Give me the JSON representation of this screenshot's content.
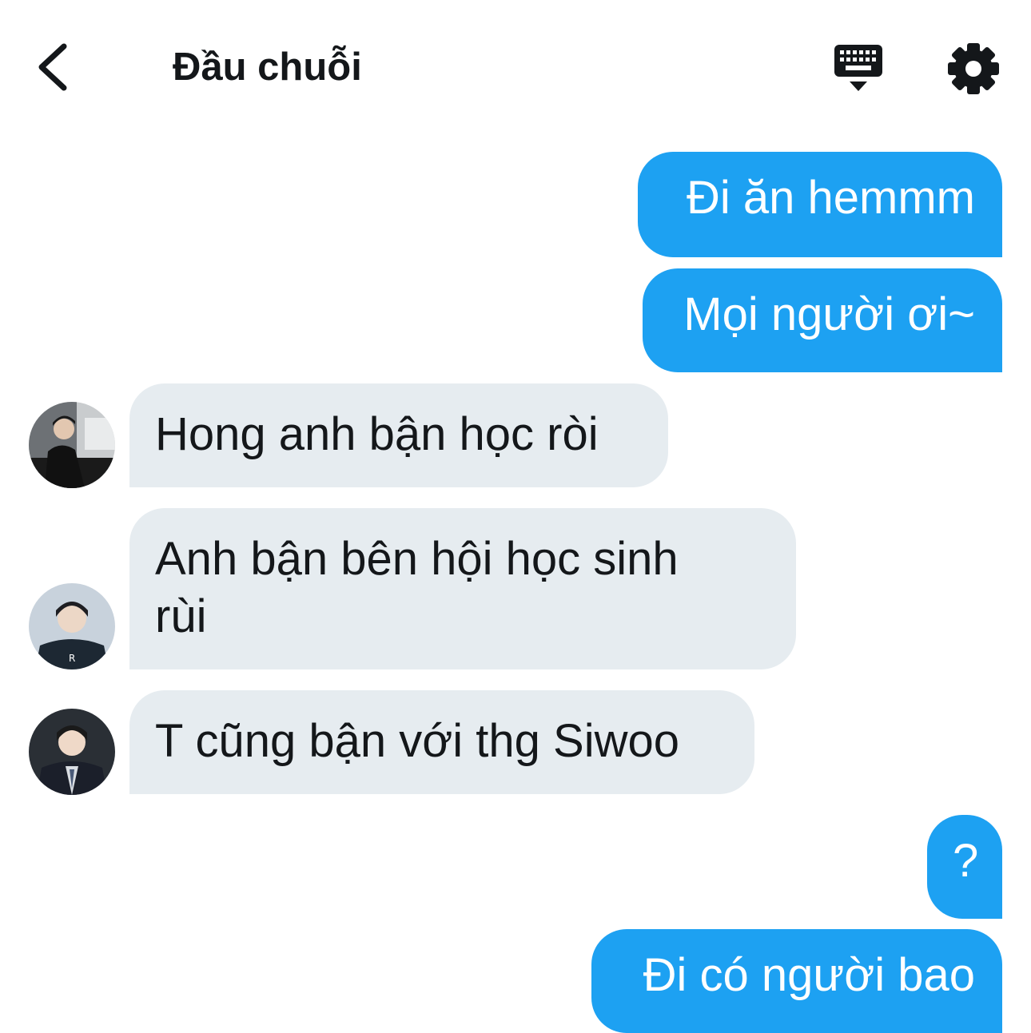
{
  "header": {
    "title": "Đầu chuỗi",
    "back_icon": "chevron-left-icon",
    "keyboard_icon": "keyboard-icon",
    "settings_icon": "gear-icon"
  },
  "messages": [
    {
      "direction": "out",
      "text": "Đi ăn hemmm"
    },
    {
      "direction": "out",
      "text": "Mọi người ơi~"
    },
    {
      "direction": "in",
      "text": "Hong anh bận học ròi"
    },
    {
      "direction": "in",
      "text": "Anh bận bên hội học sinh rùi",
      "lines": [
        "Anh bận bên hội học sinh",
        "rùi"
      ]
    },
    {
      "direction": "in",
      "text": "T cũng bận với thg Siwoo"
    },
    {
      "direction": "out",
      "text": "?"
    },
    {
      "direction": "out",
      "text": "Đi có người bao"
    }
  ],
  "colors": {
    "outgoing_bubble": "#1da1f2",
    "incoming_bubble": "#e6ecf0",
    "text_dark": "#14171a",
    "text_light": "#ffffff"
  }
}
